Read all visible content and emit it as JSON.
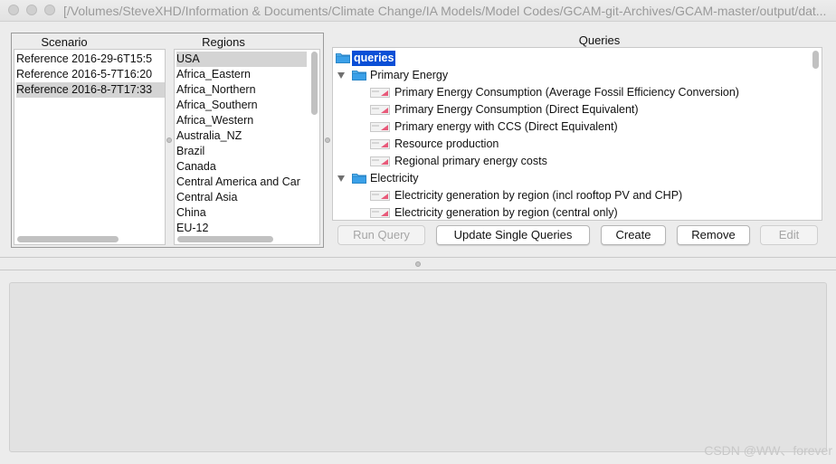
{
  "window": {
    "title": "[/Volumes/SteveXHD/Information & Documents/Climate Change/IA Models/Model Codes/GCAM-git-Archives/GCAM-master/output/dat..."
  },
  "scenario": {
    "header": "Scenario",
    "items": [
      {
        "label": "Reference 2016-29-6T15:5",
        "selected": false
      },
      {
        "label": "Reference 2016-5-7T16:20",
        "selected": false
      },
      {
        "label": "Reference 2016-8-7T17:33",
        "selected": true
      }
    ]
  },
  "regions": {
    "header": "Regions",
    "items": [
      {
        "label": "USA",
        "selected": true
      },
      {
        "label": "Africa_Eastern",
        "selected": false
      },
      {
        "label": "Africa_Northern",
        "selected": false
      },
      {
        "label": "Africa_Southern",
        "selected": false
      },
      {
        "label": "Africa_Western",
        "selected": false
      },
      {
        "label": "Australia_NZ",
        "selected": false
      },
      {
        "label": "Brazil",
        "selected": false
      },
      {
        "label": "Canada",
        "selected": false
      },
      {
        "label": "Central America and Car",
        "selected": false
      },
      {
        "label": "Central Asia",
        "selected": false
      },
      {
        "label": "China",
        "selected": false
      },
      {
        "label": "EU-12",
        "selected": false
      }
    ]
  },
  "queries": {
    "header": "Queries",
    "root": "queries",
    "groups": [
      {
        "label": "Primary Energy",
        "items": [
          "Primary Energy Consumption (Average Fossil Efficiency Conversion)",
          "Primary Energy Consumption (Direct Equivalent)",
          "Primary energy with CCS (Direct Equivalent)",
          "Resource production",
          "Regional primary energy costs"
        ]
      },
      {
        "label": "Electricity",
        "items": [
          "Electricity generation by region (incl rooftop PV and CHP)",
          "Electricity generation by region (central only)"
        ]
      }
    ]
  },
  "buttons": {
    "run_query": "Run Query",
    "update_single": "Update Single Queries",
    "create": "Create",
    "remove": "Remove",
    "edit": "Edit"
  },
  "watermark": "CSDN @WW、forever",
  "colors": {
    "selection_blue": "#0a4fd6",
    "folder_blue": "#3aa0e8",
    "row_selected": "#d4d4d4"
  }
}
